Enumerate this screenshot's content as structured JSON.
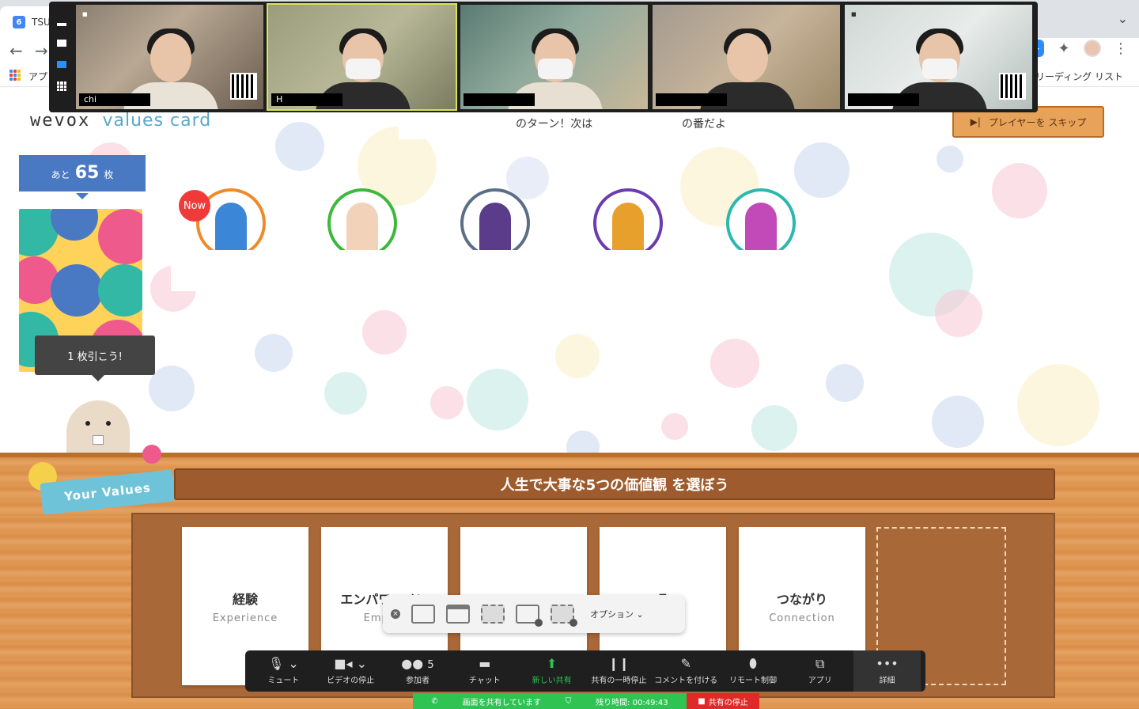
{
  "browser": {
    "tab_label": "TSU",
    "bookmarks_apps": "アプ",
    "reading_list": "リーディング リスト"
  },
  "video": {
    "tiles": [
      {
        "name": "chi"
      },
      {
        "name": "H"
      },
      {
        "name": ""
      },
      {
        "name": ""
      },
      {
        "name": ""
      }
    ]
  },
  "game": {
    "logo_main": "wevox",
    "logo_sub": "values card",
    "turn_part1": "のターン！次は",
    "turn_part2": "の番だよ",
    "skip_label": "プレイヤーを スキップ",
    "deck_prefix": "あと",
    "deck_count": "65",
    "deck_suffix": "枚",
    "draw_tip": "1 枚引こう!",
    "now_badge": "Now"
  },
  "board": {
    "your_values": "Your Values",
    "instruction": "人生で大事な5つの価値観 を選ぼう",
    "cards": [
      {
        "jp": "経験",
        "en": "Experience"
      },
      {
        "jp": "エンパワーメン",
        "en": "Empow"
      },
      {
        "jp": "",
        "en": ""
      },
      {
        "jp": "る",
        "en": "e"
      },
      {
        "jp": "つながり",
        "en": "Connection"
      }
    ]
  },
  "share_toolbar": {
    "options_label": "オプション"
  },
  "zoom_toolbar": {
    "items": [
      {
        "label": "ミュート"
      },
      {
        "label": "ビデオの停止"
      },
      {
        "label": "参加者",
        "count": "5"
      },
      {
        "label": "チャット"
      },
      {
        "label": "新しい共有"
      },
      {
        "label": "共有の一時停止"
      },
      {
        "label": "コメントを付ける"
      },
      {
        "label": "リモート制御"
      },
      {
        "label": "アプリ"
      },
      {
        "label": "詳細"
      }
    ],
    "status_sharing": "画面を共有しています",
    "status_time_label": "残り時間:",
    "status_time": "00:49:43",
    "status_stop": "共有の停止"
  }
}
